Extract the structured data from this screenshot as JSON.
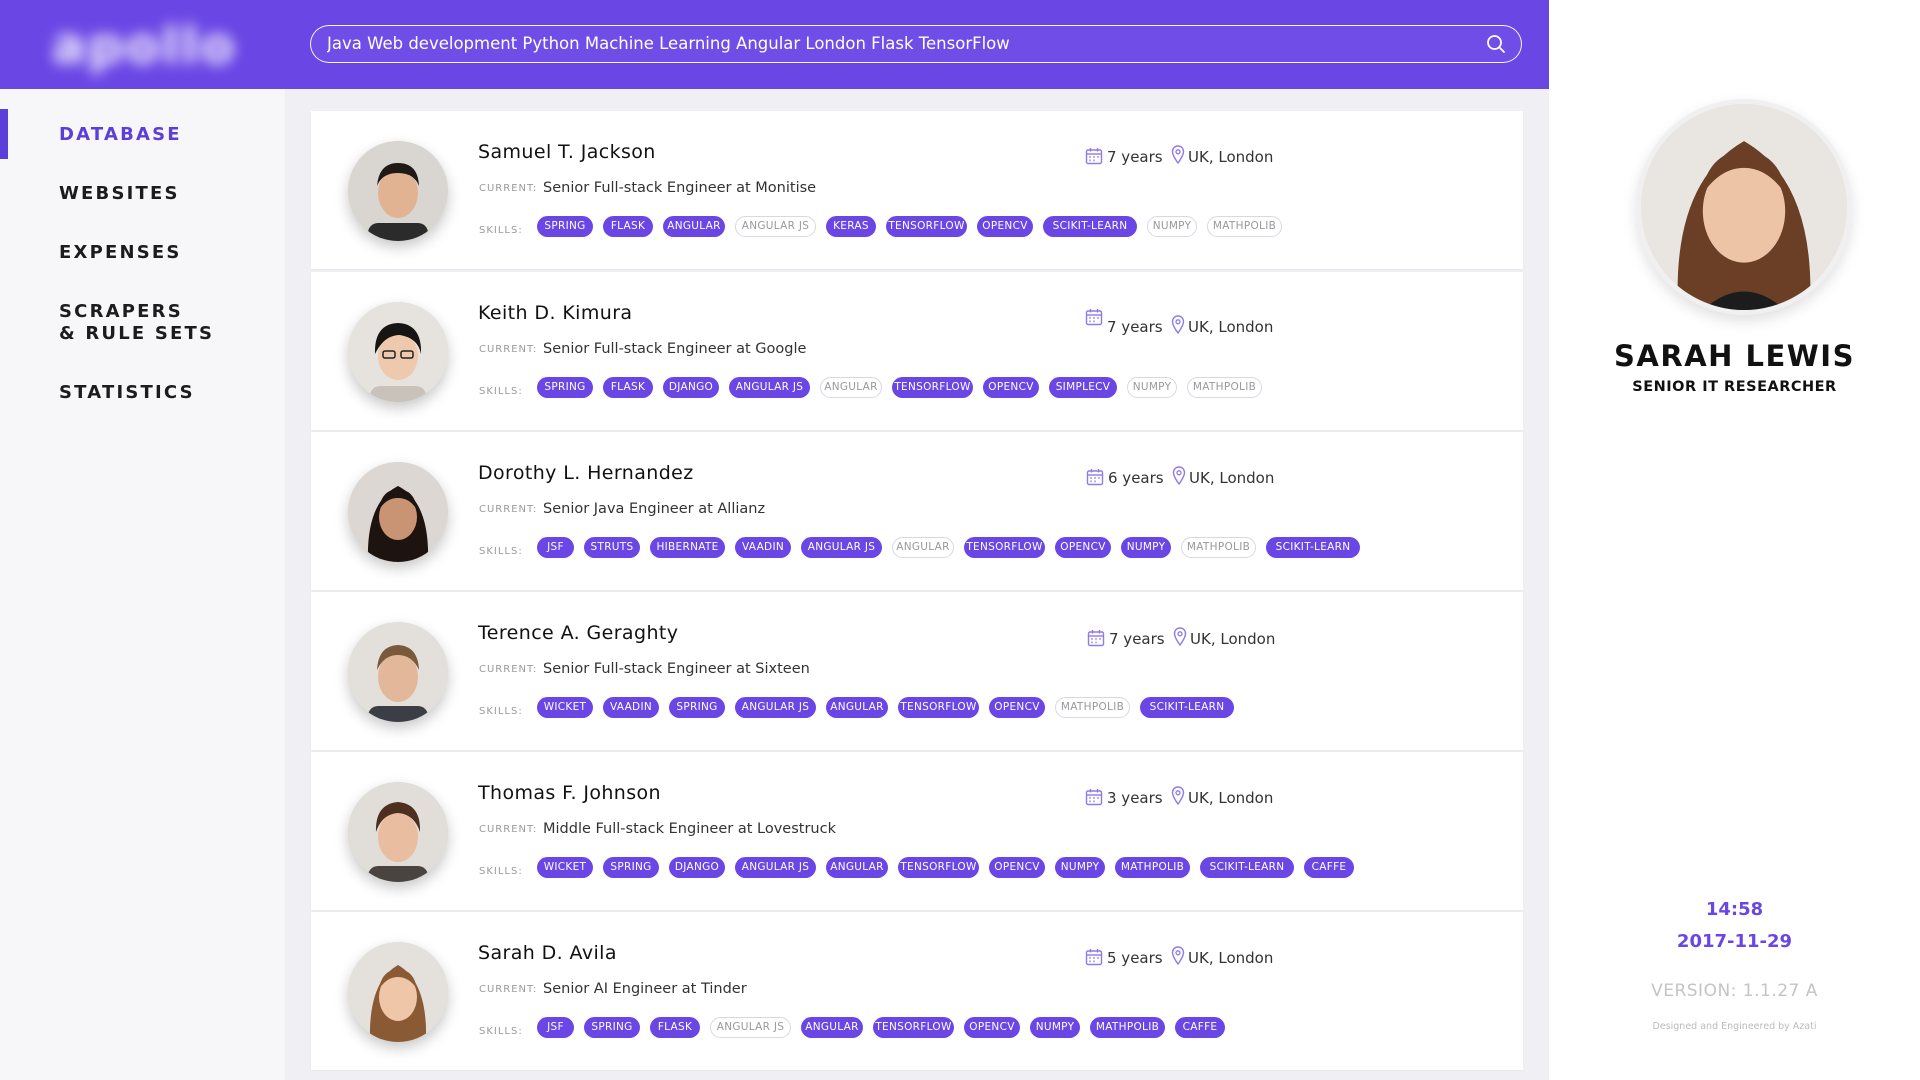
{
  "brand": {
    "logo_text": "apollo"
  },
  "search": {
    "value": "Java Web development Python Machine Learning Angular London Flask TensorFlow"
  },
  "sidebar": {
    "items": [
      {
        "label": "DATABASE",
        "active": true
      },
      {
        "label": "WEBSITES",
        "active": false
      },
      {
        "label": "EXPENSES",
        "active": false
      },
      {
        "label": "SCRAPERS",
        "label2": "& RULE SETS",
        "active": false
      },
      {
        "label": "STATISTICS",
        "active": false
      }
    ]
  },
  "labels": {
    "current": "CURRENT:",
    "skills": "SKILLS:"
  },
  "candidates": [
    {
      "name": "Samuel T. Jackson",
      "current": "Senior Full-stack Engineer at Monitise",
      "experience": "7 years",
      "location": "UK, London",
      "skills": [
        {
          "label": "SPRING",
          "filled": true
        },
        {
          "label": "FLASK",
          "filled": true
        },
        {
          "label": "ANGULAR",
          "filled": true
        },
        {
          "label": "ANGULAR JS",
          "filled": false
        },
        {
          "label": "KERAS",
          "filled": true
        },
        {
          "label": "TENSORFLOW",
          "filled": true
        },
        {
          "label": "OPENCV",
          "filled": true
        },
        {
          "label": "SCIKIT-LEARN",
          "filled": true
        },
        {
          "label": "NUMPY",
          "filled": false
        },
        {
          "label": "MATHPOLIB",
          "filled": false
        }
      ]
    },
    {
      "name": "Keith D. Kimura",
      "current": "Senior Full-stack Engineer at Google",
      "experience": "7 years",
      "location": "UK, London",
      "skills": [
        {
          "label": "SPRING",
          "filled": true
        },
        {
          "label": "FLASK",
          "filled": true
        },
        {
          "label": "DJANGO",
          "filled": true
        },
        {
          "label": "ANGULAR JS",
          "filled": true
        },
        {
          "label": "ANGULAR",
          "filled": false
        },
        {
          "label": "TENSORFLOW",
          "filled": true
        },
        {
          "label": "OPENCV",
          "filled": true
        },
        {
          "label": "SIMPLECV",
          "filled": true
        },
        {
          "label": "NUMPY",
          "filled": false
        },
        {
          "label": "MATHPOLIB",
          "filled": false
        }
      ]
    },
    {
      "name": "Dorothy L. Hernandez",
      "current": "Senior Java Engineer at Allianz",
      "experience": "6 years",
      "location": "UK, London",
      "skills": [
        {
          "label": "JSF",
          "filled": true
        },
        {
          "label": "STRUTS",
          "filled": true
        },
        {
          "label": "HIBERNATE",
          "filled": true
        },
        {
          "label": "VAADIN",
          "filled": true
        },
        {
          "label": "ANGULAR JS",
          "filled": true
        },
        {
          "label": "ANGULAR",
          "filled": false
        },
        {
          "label": "TENSORFLOW",
          "filled": true
        },
        {
          "label": "OPENCV",
          "filled": true
        },
        {
          "label": "NUMPY",
          "filled": true
        },
        {
          "label": "MATHPOLIB",
          "filled": false
        },
        {
          "label": "SCIKIT-LEARN",
          "filled": true
        }
      ]
    },
    {
      "name": "Terence A. Geraghty",
      "current": "Senior Full-stack Engineer at Sixteen",
      "experience": "7 years",
      "location": "UK, London",
      "skills": [
        {
          "label": "WICKET",
          "filled": true
        },
        {
          "label": "VAADIN",
          "filled": true
        },
        {
          "label": "SPRING",
          "filled": true
        },
        {
          "label": "ANGULAR JS",
          "filled": true
        },
        {
          "label": "ANGULAR",
          "filled": true
        },
        {
          "label": "TENSORFLOW",
          "filled": true
        },
        {
          "label": "OPENCV",
          "filled": true
        },
        {
          "label": "MATHPOLIB",
          "filled": false
        },
        {
          "label": "SCIKIT-LEARN",
          "filled": true
        }
      ]
    },
    {
      "name": "Thomas F. Johnson",
      "current": "Middle Full-stack Engineer at Lovestruck",
      "experience": "3 years",
      "location": "UK, London",
      "skills": [
        {
          "label": "WICKET",
          "filled": true
        },
        {
          "label": "SPRING",
          "filled": true
        },
        {
          "label": "DJANGO",
          "filled": true
        },
        {
          "label": "ANGULAR JS",
          "filled": true
        },
        {
          "label": "ANGULAR",
          "filled": true
        },
        {
          "label": "TENSORFLOW",
          "filled": true
        },
        {
          "label": "OPENCV",
          "filled": true
        },
        {
          "label": "NUMPY",
          "filled": true
        },
        {
          "label": "MATHPOLIB",
          "filled": true
        },
        {
          "label": "SCIKIT-LEARN",
          "filled": true
        },
        {
          "label": "CAFFE",
          "filled": true
        }
      ]
    },
    {
      "name": "Sarah D. Avila",
      "current": "Senior AI Engineer at Tinder",
      "experience": "5 years",
      "location": "UK, London",
      "skills": [
        {
          "label": "JSF",
          "filled": true
        },
        {
          "label": "SPRING",
          "filled": true
        },
        {
          "label": "FLASK",
          "filled": true
        },
        {
          "label": "ANGULAR JS",
          "filled": false
        },
        {
          "label": "ANGULAR",
          "filled": true
        },
        {
          "label": "TENSORFLOW",
          "filled": true
        },
        {
          "label": "OPENCV",
          "filled": true
        },
        {
          "label": "NUMPY",
          "filled": true
        },
        {
          "label": "MATHPOLIB",
          "filled": true
        },
        {
          "label": "CAFFE",
          "filled": true
        }
      ]
    }
  ],
  "profile": {
    "name": "SARAH LEWIS",
    "role": "SENIOR IT RESEARCHER"
  },
  "footer": {
    "time": "14:58",
    "date": "2017-11-29",
    "version": "VERSION: 1.1.27 A",
    "credits": "Designed and Engineered by Azati"
  },
  "colors": {
    "accent": "#6a46e5",
    "tag_outline": "#d8d8e4"
  },
  "icons": {
    "search": "search-icon",
    "calendar": "calendar-icon",
    "location": "location-pin-icon"
  }
}
